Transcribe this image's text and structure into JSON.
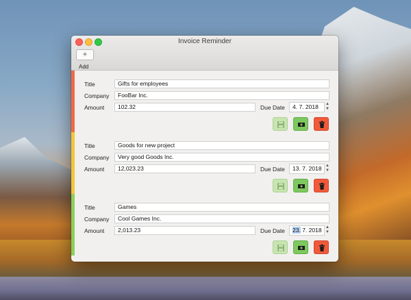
{
  "window": {
    "title": "Invoice Reminder"
  },
  "toolbar": {
    "add_icon": "+",
    "add_label": "Add"
  },
  "labels": {
    "title": "Title",
    "company": "Company",
    "amount": "Amount",
    "due_date": "Due Date"
  },
  "colors": {
    "red": "#f26a45",
    "yellow": "#f3c63b",
    "green": "#8ccf5c"
  },
  "invoices": [
    {
      "title": "Gifts for employees",
      "company": "FooBar Inc.",
      "amount": "102.32",
      "due_day": "4.",
      "due_rest": " 7. 2018",
      "stripe_color": "red"
    },
    {
      "title": "Goods for new project",
      "company": "Very good Goods Inc.",
      "amount": "12,023.23",
      "due_day": "13.",
      "due_rest": " 7. 2018",
      "stripe_color": "yellow"
    },
    {
      "title": "Games",
      "company": "Cool Games Inc.",
      "amount": "2,013.23",
      "due_day": "23.",
      "due_rest": " 7. 2018",
      "stripe_color": "green",
      "day_selected": true
    }
  ]
}
